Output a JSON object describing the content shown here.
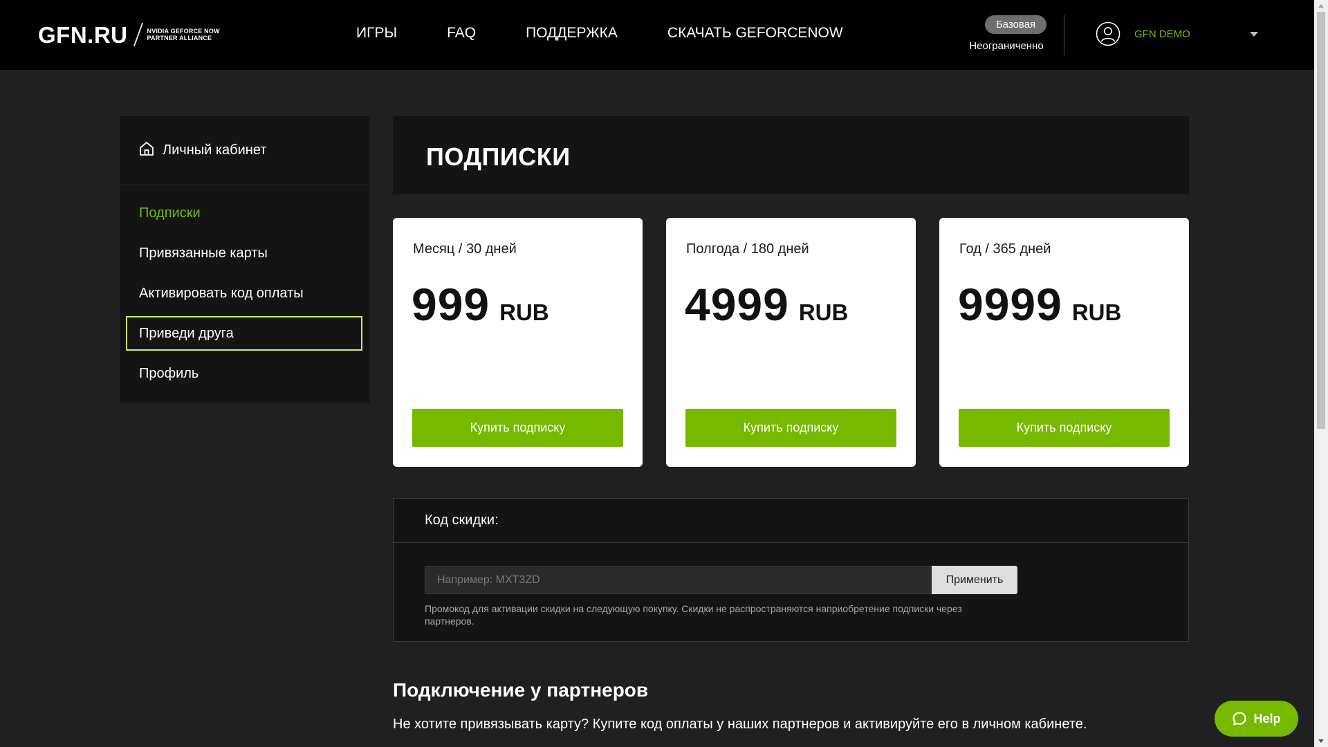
{
  "header": {
    "logo_main": "GFN.RU",
    "logo_sub_line1": "NVIDIA GEFORCE NOW",
    "logo_sub_line2": "PARTNER ALLIANCE",
    "nav": [
      {
        "label": "ИГРЫ"
      },
      {
        "label": "FAQ"
      },
      {
        "label": "ПОДДЕРЖКА"
      },
      {
        "label": "СКАЧАТЬ GEFORCENOW"
      }
    ],
    "plan_badge": "Базовая",
    "plan_status": "Неограниченно",
    "user_name": "GFN DEMO",
    "icons": {
      "user": "user-circle-icon",
      "caret": "caret-down-icon"
    }
  },
  "sidebar": {
    "title": "Личный кабинет",
    "title_icon": "home-icon",
    "items": [
      {
        "label": "Подписки",
        "state": "active"
      },
      {
        "label": "Привязанные карты"
      },
      {
        "label": "Активировать код оплаты"
      },
      {
        "label": "Приведи друга",
        "state": "focused"
      },
      {
        "label": "Профиль"
      }
    ]
  },
  "main": {
    "page_title": "ПОДПИСКИ",
    "plans": [
      {
        "period": "Месяц / 30 дней",
        "price": "999",
        "currency": "RUB",
        "button": "Купить подписку"
      },
      {
        "period": "Полгода / 180 дней",
        "price": "4999",
        "currency": "RUB",
        "button": "Купить подписку"
      },
      {
        "period": "Год / 365 дней",
        "price": "9999",
        "currency": "RUB",
        "button": "Купить подписку"
      }
    ],
    "discount": {
      "label": "Код скидки:",
      "placeholder": "Например: MXT3ZD",
      "value": "",
      "apply_button": "Применить",
      "hint": "Промокод для активации скидки на следующую покупку. Скидки не распространяются наприобретение подписки через партнеров."
    },
    "partners": {
      "title": "Подключение у партнеров",
      "text": "Не хотите привязывать карту? Купите код оплаты у наших партнеров и активируйте его в личном кабинете."
    }
  },
  "help_button": {
    "label": "Help",
    "icon": "chat-bubble-icon"
  },
  "colors": {
    "accent": "#76b900",
    "background": "#202020",
    "panel": "#141414",
    "header": "#000000",
    "focus_outline": "#c6f25a"
  }
}
